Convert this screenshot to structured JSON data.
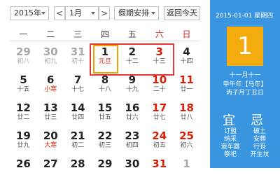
{
  "toolbar": {
    "year": "2015年",
    "prev": "<",
    "month": "1月",
    "next": ">",
    "holiday": "假期安排",
    "today_button": "返回今天"
  },
  "weekdays": [
    "一",
    "二",
    "三",
    "四",
    "五",
    "六",
    "日"
  ],
  "weeks": [
    [
      {
        "d": "29",
        "l": "初八",
        "other": true
      },
      {
        "d": "30",
        "l": "初九",
        "other": true
      },
      {
        "d": "31",
        "l": "初十",
        "other": true
      },
      {
        "d": "1",
        "l": "元旦",
        "red_lunar": true,
        "today": true
      },
      {
        "d": "2",
        "l": "十二"
      },
      {
        "d": "3",
        "l": "十三",
        "weekend": true
      },
      {
        "d": "4",
        "l": "十四"
      }
    ],
    [
      {
        "d": "5",
        "l": "十五"
      },
      {
        "d": "6",
        "l": "小寒",
        "red_lunar": true
      },
      {
        "d": "7",
        "l": "十七"
      },
      {
        "d": "8",
        "l": "十八"
      },
      {
        "d": "9",
        "l": "十九"
      },
      {
        "d": "10",
        "l": "二十",
        "weekend": true
      },
      {
        "d": "11",
        "l": "廿一",
        "weekend": true
      }
    ],
    [
      {
        "d": "12",
        "l": "廿二"
      },
      {
        "d": "13",
        "l": "廿三"
      },
      {
        "d": "14",
        "l": "廿四"
      },
      {
        "d": "15",
        "l": "廿五"
      },
      {
        "d": "16",
        "l": "廿六"
      },
      {
        "d": "17",
        "l": "廿七",
        "weekend": true
      },
      {
        "d": "18",
        "l": "廿八",
        "weekend": true
      }
    ],
    [
      {
        "d": "19",
        "l": "廿九"
      },
      {
        "d": "20",
        "l": "大寒",
        "red_lunar": true
      },
      {
        "d": "21",
        "l": "初二"
      },
      {
        "d": "22",
        "l": "初三"
      },
      {
        "d": "23",
        "l": "初四"
      },
      {
        "d": "24",
        "l": "初五",
        "weekend": true
      },
      {
        "d": "25",
        "l": "初六",
        "weekend": true
      }
    ],
    [
      {
        "d": "26",
        "l": ""
      },
      {
        "d": "27",
        "l": ""
      },
      {
        "d": "28",
        "l": ""
      },
      {
        "d": "29",
        "l": ""
      },
      {
        "d": "30",
        "l": ""
      },
      {
        "d": "31",
        "l": "",
        "weekend": true
      },
      {
        "d": "1",
        "l": "",
        "other": true
      }
    ]
  ],
  "side": {
    "date_line": "2015-01-01 星期四",
    "big_day": "1",
    "lunar_month_day": "十一月十一",
    "ganzhi_year": "甲午年【马年】",
    "ganzhi_month_day": "丙子月丁丑日",
    "yi_title": "宜",
    "ji_title": "忌",
    "yi_items": [
      "订盟",
      "纳采",
      "造车器",
      "祭祀"
    ],
    "ji_items": [
      "破土",
      "安葬",
      "行丧",
      "开生坟"
    ]
  },
  "colors": {
    "accent_blue": "#3a95e0",
    "today_orange": "#f4ab0d",
    "holiday_red": "#e53935"
  }
}
